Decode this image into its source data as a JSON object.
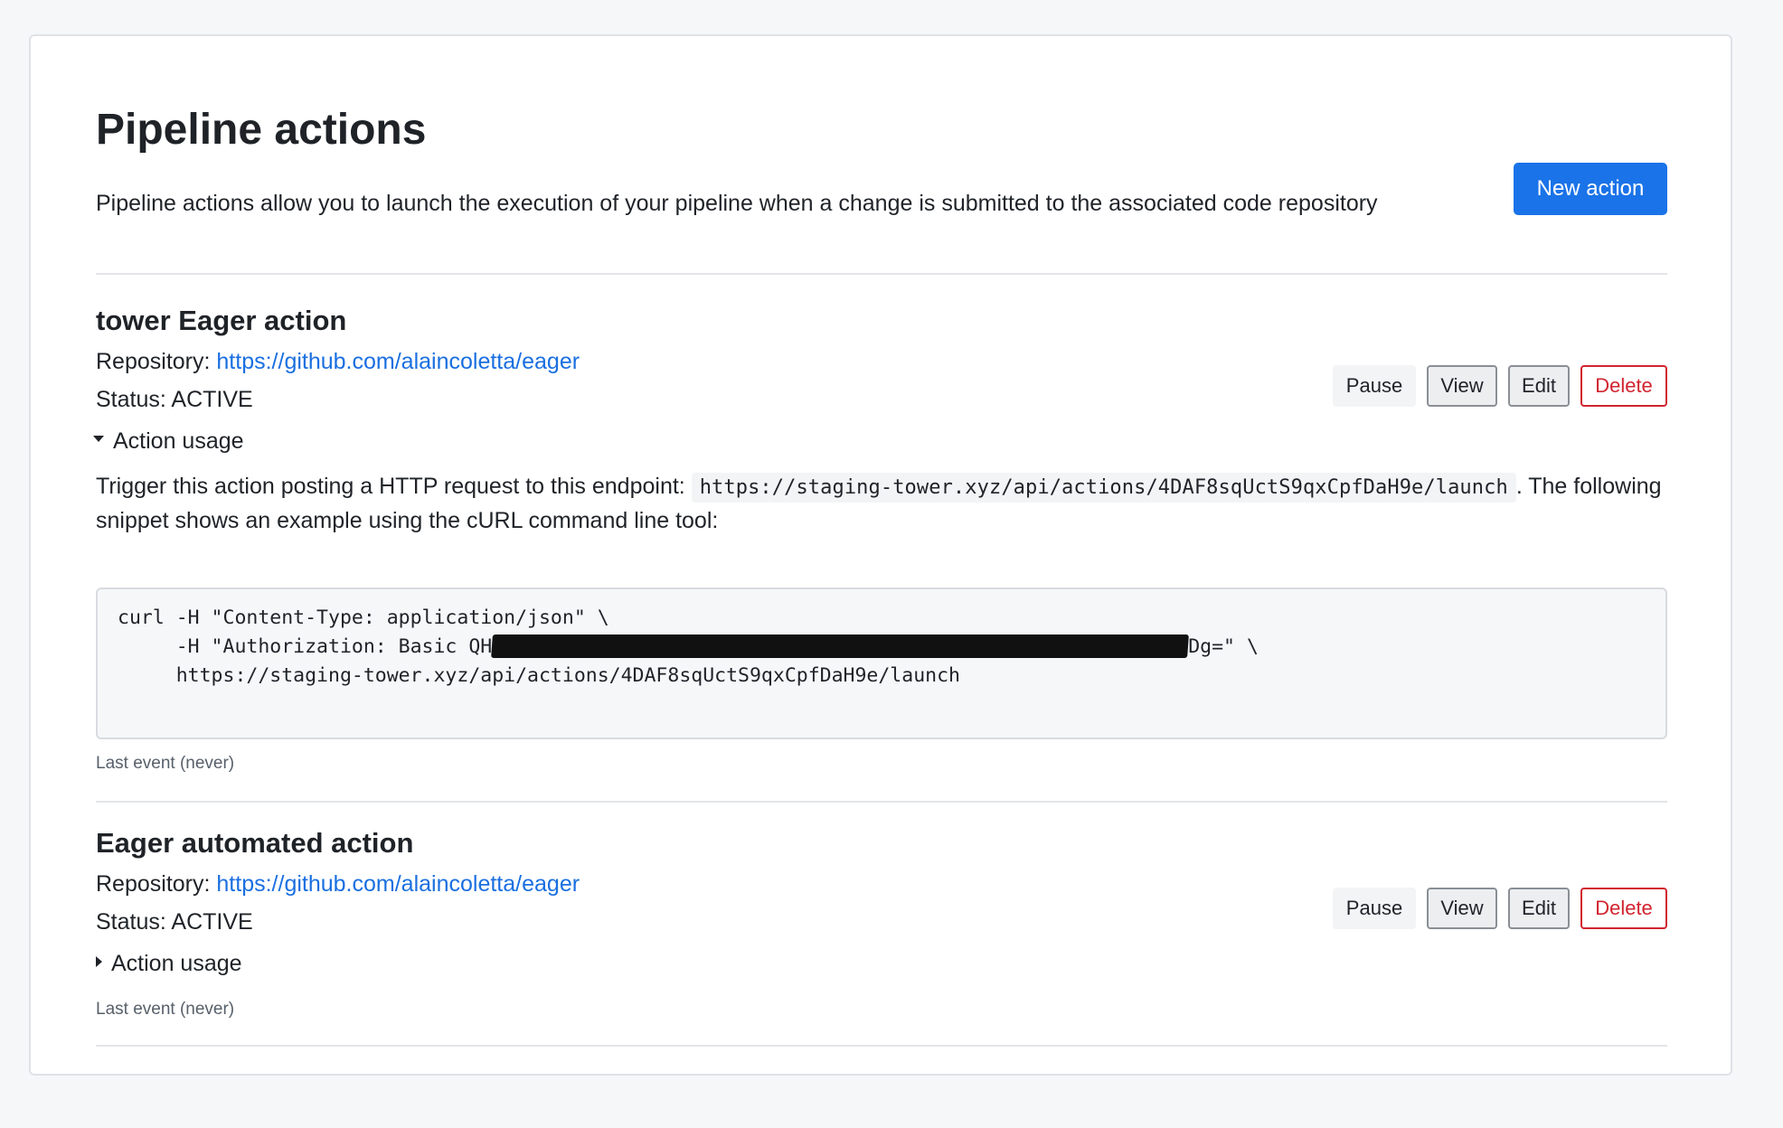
{
  "page": {
    "title": "Pipeline actions",
    "description": "Pipeline actions allow you to launch the execution of your pipeline when a change is submitted to the associated code repository",
    "new_action_label": "New action"
  },
  "actions": [
    {
      "title": "tower Eager action",
      "repository_label": "Repository:",
      "repository_url": "https://github.com/alaincoletta/eager",
      "status_label": "Status:",
      "status": "ACTIVE",
      "usage_label": "Action usage",
      "usage_expanded": true,
      "usage_text_before": "Trigger this action posting a HTTP request to this endpoint:",
      "endpoint": "https://staging-tower.xyz/api/actions/4DAF8sqUctS9qxCpfDaH9e/launch",
      "usage_text_after": ". The following snippet shows an example using the cURL command line tool:",
      "snippet_line1": "curl -H \"Content-Type: application/json\" \\",
      "snippet_line2_prefix": "     -H \"Authorization: Basic QH",
      "snippet_line2_suffix": "Dg=\" \\",
      "snippet_line3": "     https://staging-tower.xyz/api/actions/4DAF8sqUctS9qxCpfDaH9e/launch",
      "last_event": "Last event (never)",
      "buttons": {
        "pause": "Pause",
        "view": "View",
        "edit": "Edit",
        "delete": "Delete"
      }
    },
    {
      "title": "Eager automated action",
      "repository_label": "Repository:",
      "repository_url": "https://github.com/alaincoletta/eager",
      "status_label": "Status:",
      "status": "ACTIVE",
      "usage_label": "Action usage",
      "usage_expanded": false,
      "last_event": "Last event (never)",
      "buttons": {
        "pause": "Pause",
        "view": "View",
        "edit": "Edit",
        "delete": "Delete"
      }
    }
  ],
  "colors": {
    "primary": "#1a73e8",
    "link": "#1a6fe0",
    "danger": "#d1242f",
    "page_background": "#f6f7f9"
  },
  "icons": {
    "expanded": "caret-down-icon",
    "collapsed": "caret-right-icon"
  }
}
